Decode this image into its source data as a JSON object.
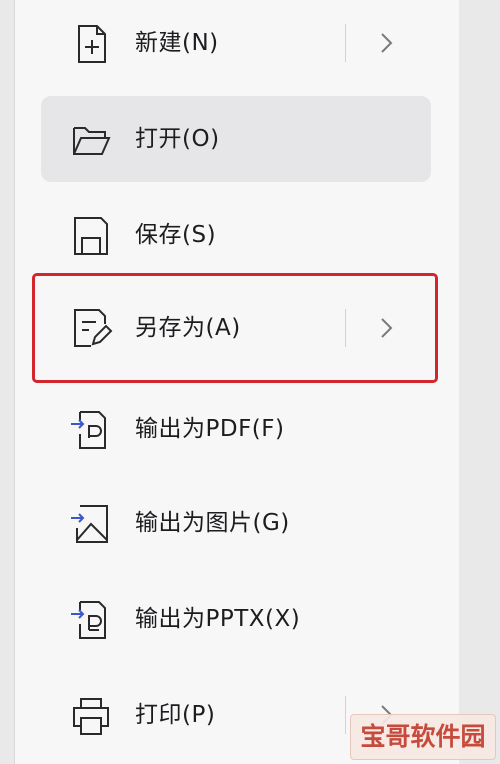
{
  "menu": {
    "items": [
      {
        "label": "新建(N)",
        "icon": "new-file-icon",
        "has_submenu": true
      },
      {
        "label": "打开(O)",
        "icon": "folder-open-icon",
        "has_submenu": false,
        "hovered": true
      },
      {
        "label": "保存(S)",
        "icon": "save-icon",
        "has_submenu": false
      },
      {
        "label": "另存为(A)",
        "icon": "save-as-icon",
        "has_submenu": true,
        "highlighted": true
      },
      {
        "label": "输出为PDF(F)",
        "icon": "export-pdf-icon",
        "has_submenu": false
      },
      {
        "label": "输出为图片(G)",
        "icon": "export-image-icon",
        "has_submenu": false
      },
      {
        "label": "输出为PPTX(X)",
        "icon": "export-pptx-icon",
        "has_submenu": false
      },
      {
        "label": "打印(P)",
        "icon": "print-icon",
        "has_submenu": true
      }
    ]
  },
  "watermark": {
    "text": "宝哥软件园"
  },
  "colors": {
    "highlight_border": "#d3252c",
    "hover_bg": "#e6e6e8",
    "text": "#1d1d1f",
    "icon_accent": "#3b58c9"
  }
}
